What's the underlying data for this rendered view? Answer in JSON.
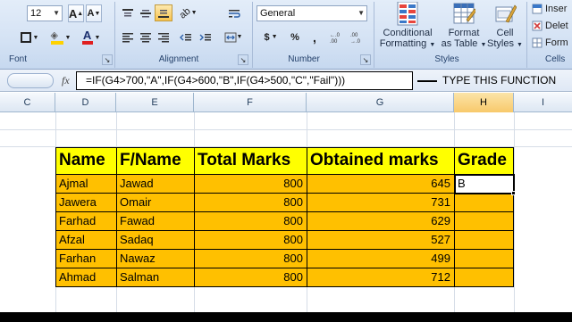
{
  "ribbon": {
    "font_size": "12",
    "number_format": "General",
    "groups": {
      "font": "Font",
      "alignment": "Alignment",
      "number": "Number",
      "styles": "Styles",
      "cells": "Cells"
    },
    "styles": {
      "conditional_line1": "Conditional",
      "conditional_line2": "Formatting",
      "format_table_line1": "Format",
      "format_table_line2": "as Table",
      "cell_styles_line1": "Cell",
      "cell_styles_line2": "Styles"
    },
    "cells": {
      "insert": "Inser",
      "delete": "Delet",
      "format": "Form"
    },
    "number_buttons": {
      "currency": "$",
      "percent": "%",
      "comma": ","
    }
  },
  "formula_bar": {
    "fx": "fx",
    "formula": "=IF(G4>700,\"A\",IF(G4>600,\"B\",IF(G4>500,\"C\",\"Fail\")))",
    "annotation": "TYPE THIS FUNCTION"
  },
  "columns": [
    "C",
    "D",
    "E",
    "F",
    "G",
    "H",
    "I"
  ],
  "table": {
    "headers": [
      "Name",
      "F/Name",
      "Total Marks",
      "Obtained marks",
      "Grade"
    ],
    "rows": [
      [
        "Ajmal",
        "Jawad",
        "800",
        "645",
        "B"
      ],
      [
        "Jawera",
        "Omair",
        "800",
        "731",
        ""
      ],
      [
        "Farhad",
        "Fawad",
        "800",
        "629",
        ""
      ],
      [
        "Afzal",
        "Sadaq",
        "800",
        "527",
        ""
      ],
      [
        "Farhan",
        "Nawaz",
        "800",
        "499",
        ""
      ],
      [
        "Ahmad",
        "Salman",
        "800",
        "712",
        ""
      ]
    ]
  },
  "colors": {
    "header_fill": "#ffff00",
    "body_fill": "#ffc000",
    "ribbon_bg": "#d4e2f4"
  }
}
